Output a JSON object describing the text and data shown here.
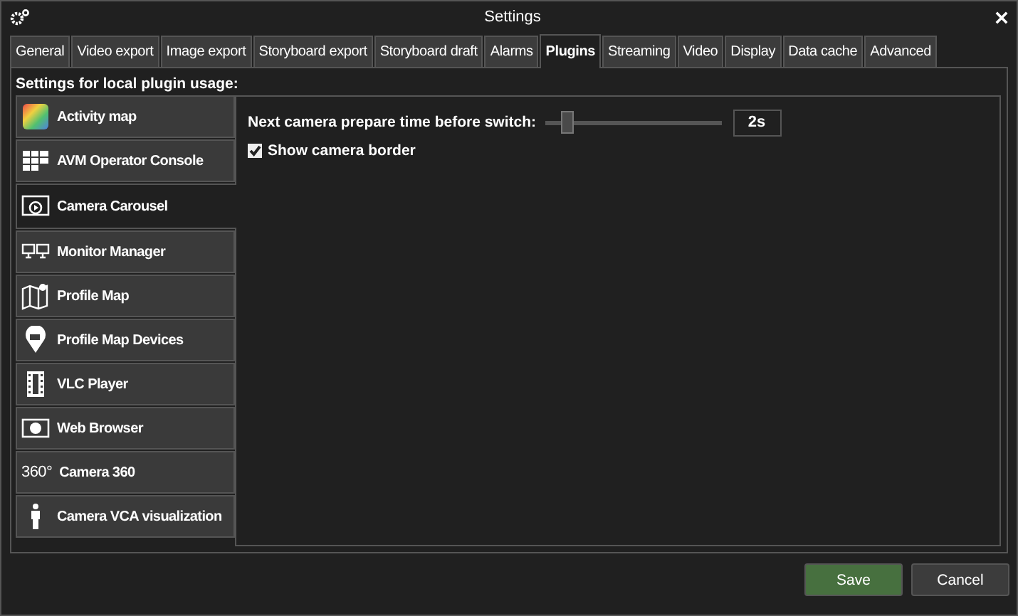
{
  "window": {
    "title": "Settings"
  },
  "tabs": [
    {
      "label": "General",
      "selected": false
    },
    {
      "label": "Video export",
      "selected": false
    },
    {
      "label": "Image export",
      "selected": false
    },
    {
      "label": "Storyboard export",
      "selected": false
    },
    {
      "label": "Storyboard draft",
      "selected": false
    },
    {
      "label": "Alarms",
      "selected": false
    },
    {
      "label": "Plugins",
      "selected": true
    },
    {
      "label": "Streaming",
      "selected": false
    },
    {
      "label": "Video",
      "selected": false
    },
    {
      "label": "Display",
      "selected": false
    },
    {
      "label": "Data cache",
      "selected": false
    },
    {
      "label": "Advanced",
      "selected": false
    }
  ],
  "heading": "Settings for local plugin usage:",
  "plugins": [
    {
      "label": "Activity map",
      "selected": false
    },
    {
      "label": "AVM Operator Console",
      "selected": false
    },
    {
      "label": "Camera Carousel",
      "selected": true
    },
    {
      "label": "Monitor Manager",
      "selected": false
    },
    {
      "label": "Profile Map",
      "selected": false
    },
    {
      "label": "Profile Map Devices",
      "selected": false
    },
    {
      "label": "VLC Player",
      "selected": false
    },
    {
      "label": "Web Browser",
      "selected": false
    },
    {
      "label": "Camera 360",
      "selected": false,
      "icon_text": "360°"
    },
    {
      "label": "Camera VCA visualization",
      "selected": false
    }
  ],
  "settings": {
    "slider_label": "Next camera prepare time before switch:",
    "slider": {
      "level": 0.1
    },
    "slider_value": "2s",
    "checkbox": {
      "label": "Show camera border",
      "checked": true
    }
  },
  "buttons": [
    {
      "label": "Save",
      "kind": "primary"
    },
    {
      "label": "Cancel",
      "kind": "secondary"
    }
  ]
}
